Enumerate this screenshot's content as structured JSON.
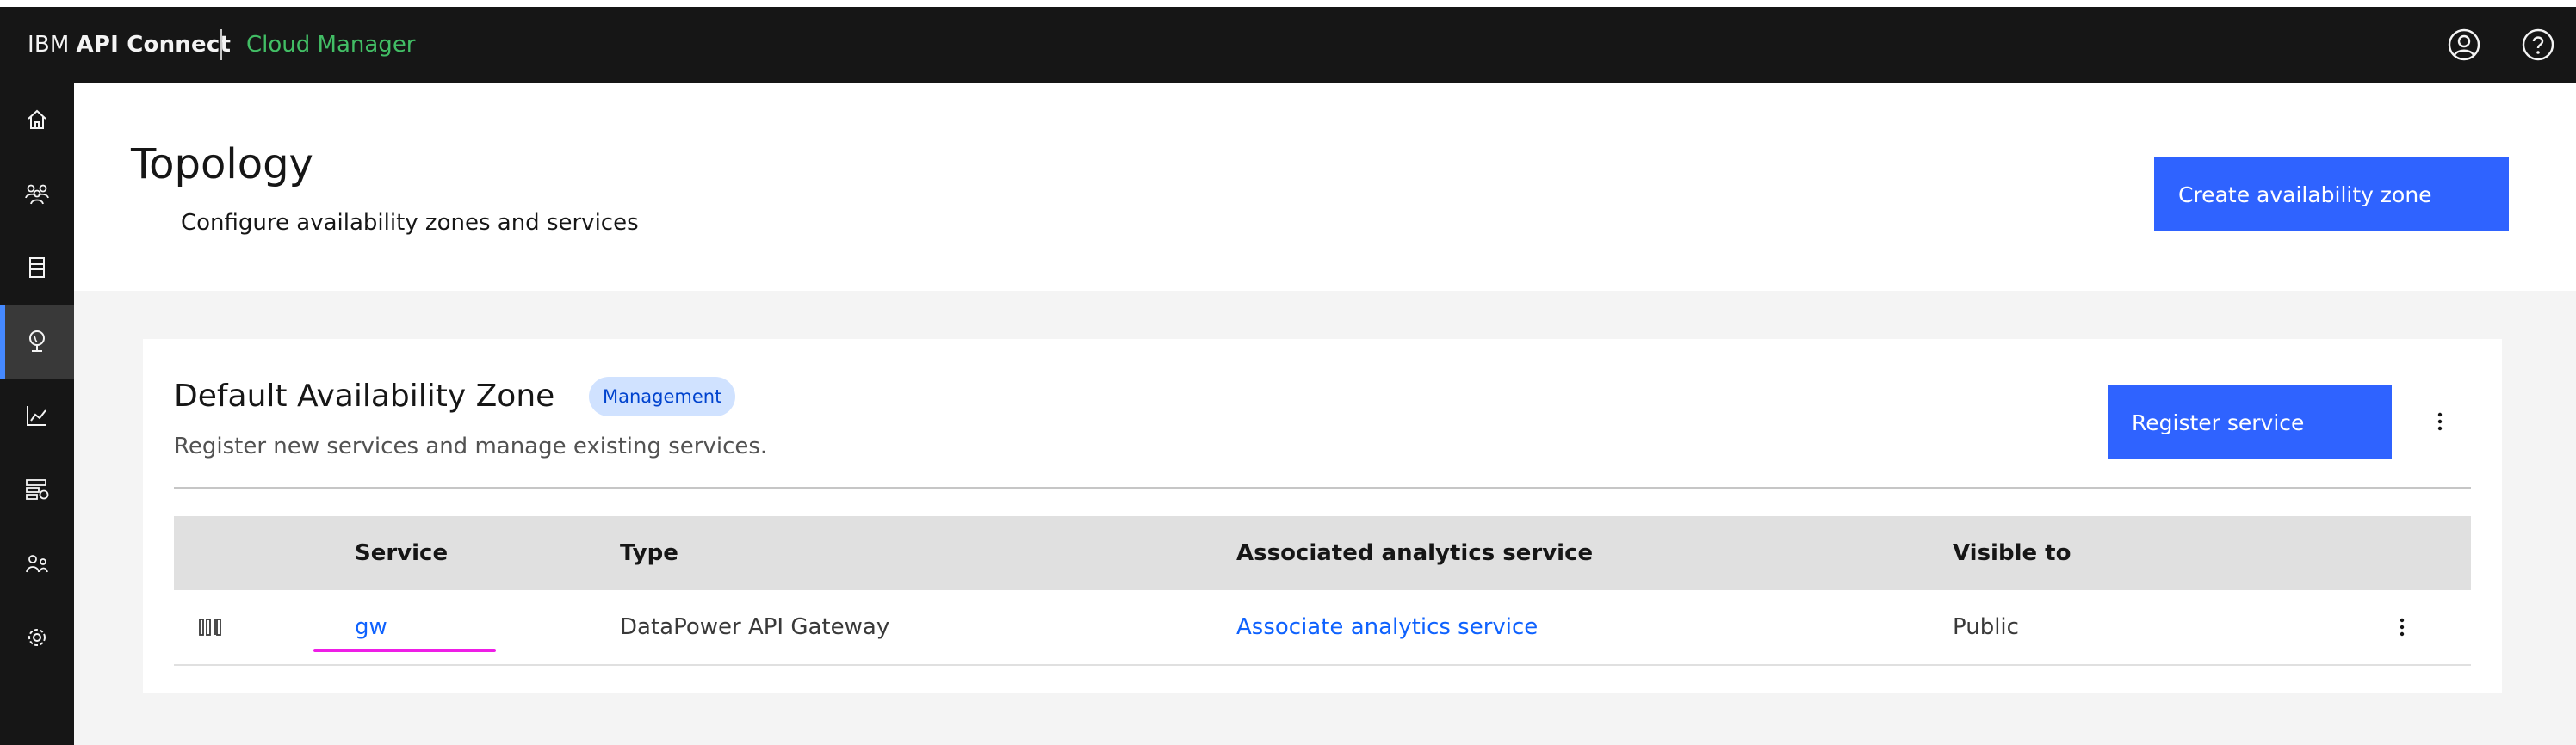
{
  "header": {
    "brand_prefix": "IBM",
    "brand_name": "API Connect",
    "product_name": "Cloud Manager",
    "icons": [
      "user-avatar-icon",
      "help-icon"
    ]
  },
  "sidenav": {
    "items": [
      {
        "icon": "home-icon"
      },
      {
        "icon": "users-icon"
      },
      {
        "icon": "catalog-icon"
      },
      {
        "icon": "topology-icon",
        "active": true
      },
      {
        "icon": "analytics-icon"
      },
      {
        "icon": "resources-icon"
      },
      {
        "icon": "member-icon"
      },
      {
        "icon": "settings-icon"
      }
    ]
  },
  "page": {
    "title": "Topology",
    "subtitle": "Configure availability zones and services",
    "create_button": "Create availability zone"
  },
  "zone": {
    "title": "Default Availability Zone",
    "tag": "Management",
    "description": "Register new services and manage existing services.",
    "register_button": "Register service"
  },
  "table": {
    "columns": [
      "Service",
      "Type",
      "Associated analytics service",
      "Visible to"
    ],
    "rows": [
      {
        "service": "gw",
        "type": "DataPower API Gateway",
        "analytics": "Associate analytics service",
        "visible_to": "Public"
      }
    ]
  },
  "colors": {
    "header_bg": "#161616",
    "product_green": "#42be65",
    "primary_blue": "#2f63ff",
    "link_blue": "#0f62fe",
    "tag_bg": "#d0e2ff",
    "highlight_magenta": "#ee1ee6"
  }
}
